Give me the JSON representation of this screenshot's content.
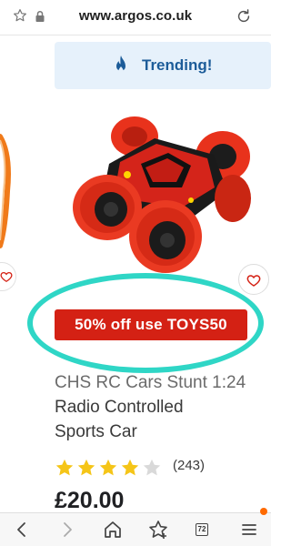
{
  "browser": {
    "url": "www.argos.co.uk",
    "tab_count": "72"
  },
  "trending": {
    "label": "Trending!"
  },
  "promo": {
    "text": "50% off use TOYS50",
    "circle_color": "#2fd6c6",
    "badge_color": "#d42114"
  },
  "product": {
    "title_lines": [
      "CHS RC Cars Stunt 1:24",
      "Radio Controlled",
      "Sports Car"
    ],
    "rating": 4,
    "rating_max": 5,
    "review_count": "(243)",
    "price": "£20.00"
  },
  "colors": {
    "star_filled": "#f5c518",
    "star_empty": "#d9d9d9",
    "trending_text": "#1c5c99",
    "trending_bg": "#e6f1fb",
    "heart": "#d42114"
  }
}
